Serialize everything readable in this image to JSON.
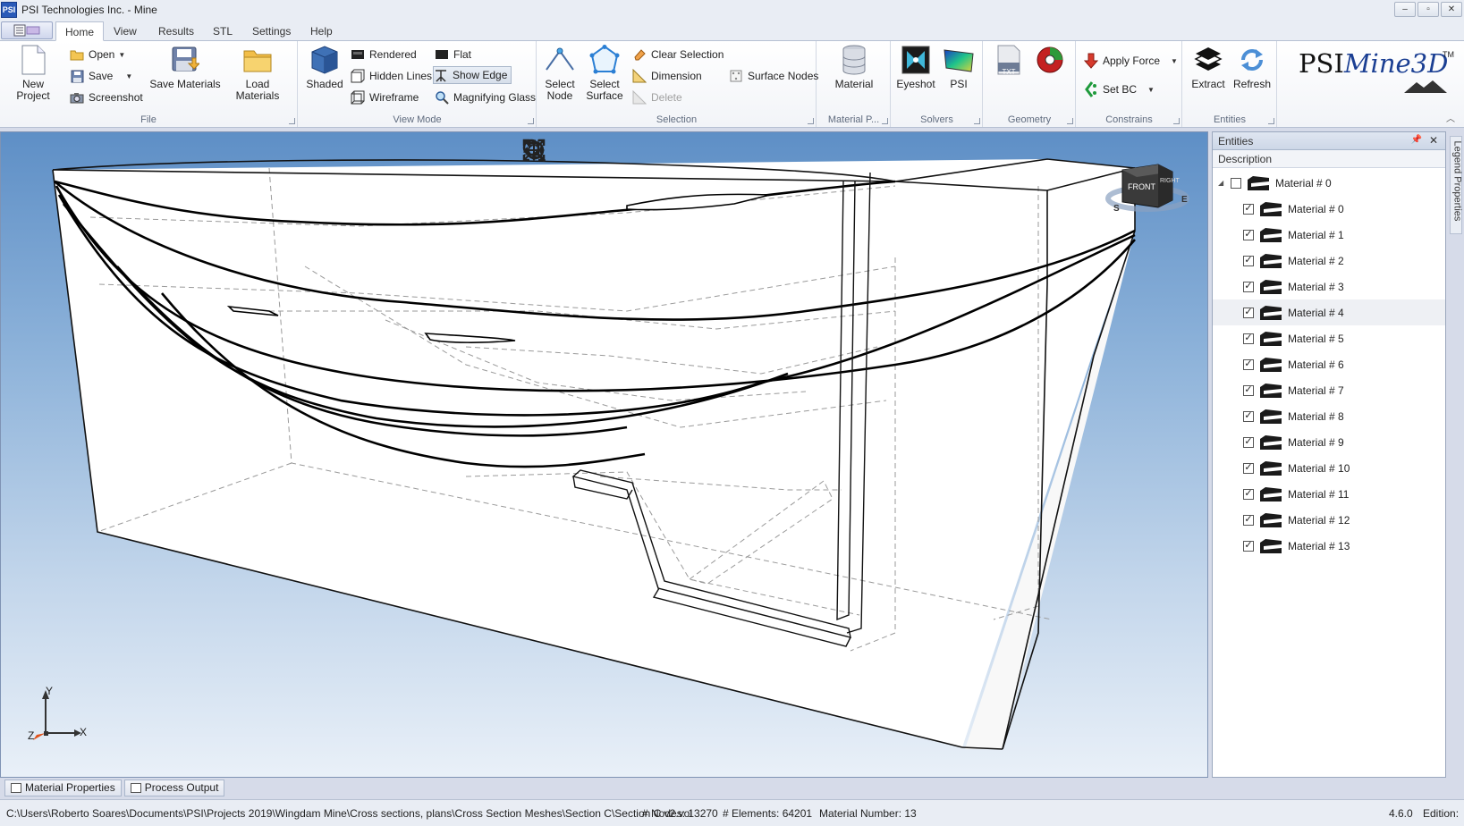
{
  "window": {
    "title": "PSI Technologies Inc. - Mine",
    "app_icon": "PSI",
    "controls": [
      "–",
      "▫",
      "✕"
    ]
  },
  "tabs": [
    "Home",
    "View",
    "Results",
    "STL",
    "Settings",
    "Help"
  ],
  "active_tab": "Home",
  "ribbon": {
    "file": {
      "label": "File",
      "new_project": "New Project",
      "open": "Open",
      "save": "Save",
      "screenshot": "Screenshot",
      "save_materials": "Save Materials",
      "load_materials": "Load Materials"
    },
    "view_mode": {
      "label": "View Mode",
      "shaded": "Shaded",
      "rendered": "Rendered",
      "hidden_lines": "Hidden Lines",
      "wireframe": "Wireframe",
      "flat": "Flat",
      "show_edge": "Show Edge",
      "magnifying_glass": "Magnifying Glass"
    },
    "selection": {
      "label": "Selection",
      "select_node_1": "Select",
      "select_node_2": "Node",
      "select_surface_1": "Select",
      "select_surface_2": "Surface",
      "clear_selection": "Clear Selection",
      "dimension": "Dimension",
      "delete": "Delete",
      "surface_nodes": "Surface Nodes"
    },
    "material_props": {
      "label": "Material P...",
      "material": "Material"
    },
    "solvers": {
      "label": "Solvers",
      "eyeshot": "Eyeshot",
      "psi": "PSI"
    },
    "geometry": {
      "label": "Geometry",
      "txt_icon_text": "TXT"
    },
    "constrains": {
      "label": "Constrains",
      "apply_force": "Apply Force",
      "set_bc": "Set BC"
    },
    "entities": {
      "label": "Entities",
      "extract": "Extract",
      "refresh": "Refresh"
    }
  },
  "brand": {
    "psi": "PSI",
    "mine": "Mine3D",
    "tm": "TM"
  },
  "viewcube": {
    "front": "FRONT",
    "right": "RIGHT",
    "compass_s": "S",
    "compass_e": "E"
  },
  "axes": {
    "x": "X",
    "y": "Y",
    "z": "Z"
  },
  "entities_panel": {
    "title": "Entities",
    "column": "Description",
    "root": "Material # 0",
    "items": [
      "Material # 0",
      "Material # 1",
      "Material # 2",
      "Material # 3",
      "Material # 4",
      "Material # 5",
      "Material # 6",
      "Material # 7",
      "Material # 8",
      "Material # 9",
      "Material # 10",
      "Material # 11",
      "Material # 12",
      "Material # 13"
    ]
  },
  "side_tab": "Legend Properties",
  "bottom_tabs": [
    "Material Properties",
    "Process Output"
  ],
  "status": {
    "path": "C:\\Users\\Roberto Soares\\Documents\\PSI\\Projects 2019\\Wingdam Mine\\Cross sections, plans\\Cross Section Meshes\\Section C\\Section C v2.vol",
    "nodes": "# Nodes: 13270",
    "elements": "# Elements: 64201",
    "material_number": "Material Number: 13",
    "version": "4.6.0",
    "edition": "Edition:"
  },
  "colors": {
    "accent": "#2a5ab8",
    "viewport_top": "#5e8fc6",
    "viewport_bottom": "#e9f0f8"
  }
}
